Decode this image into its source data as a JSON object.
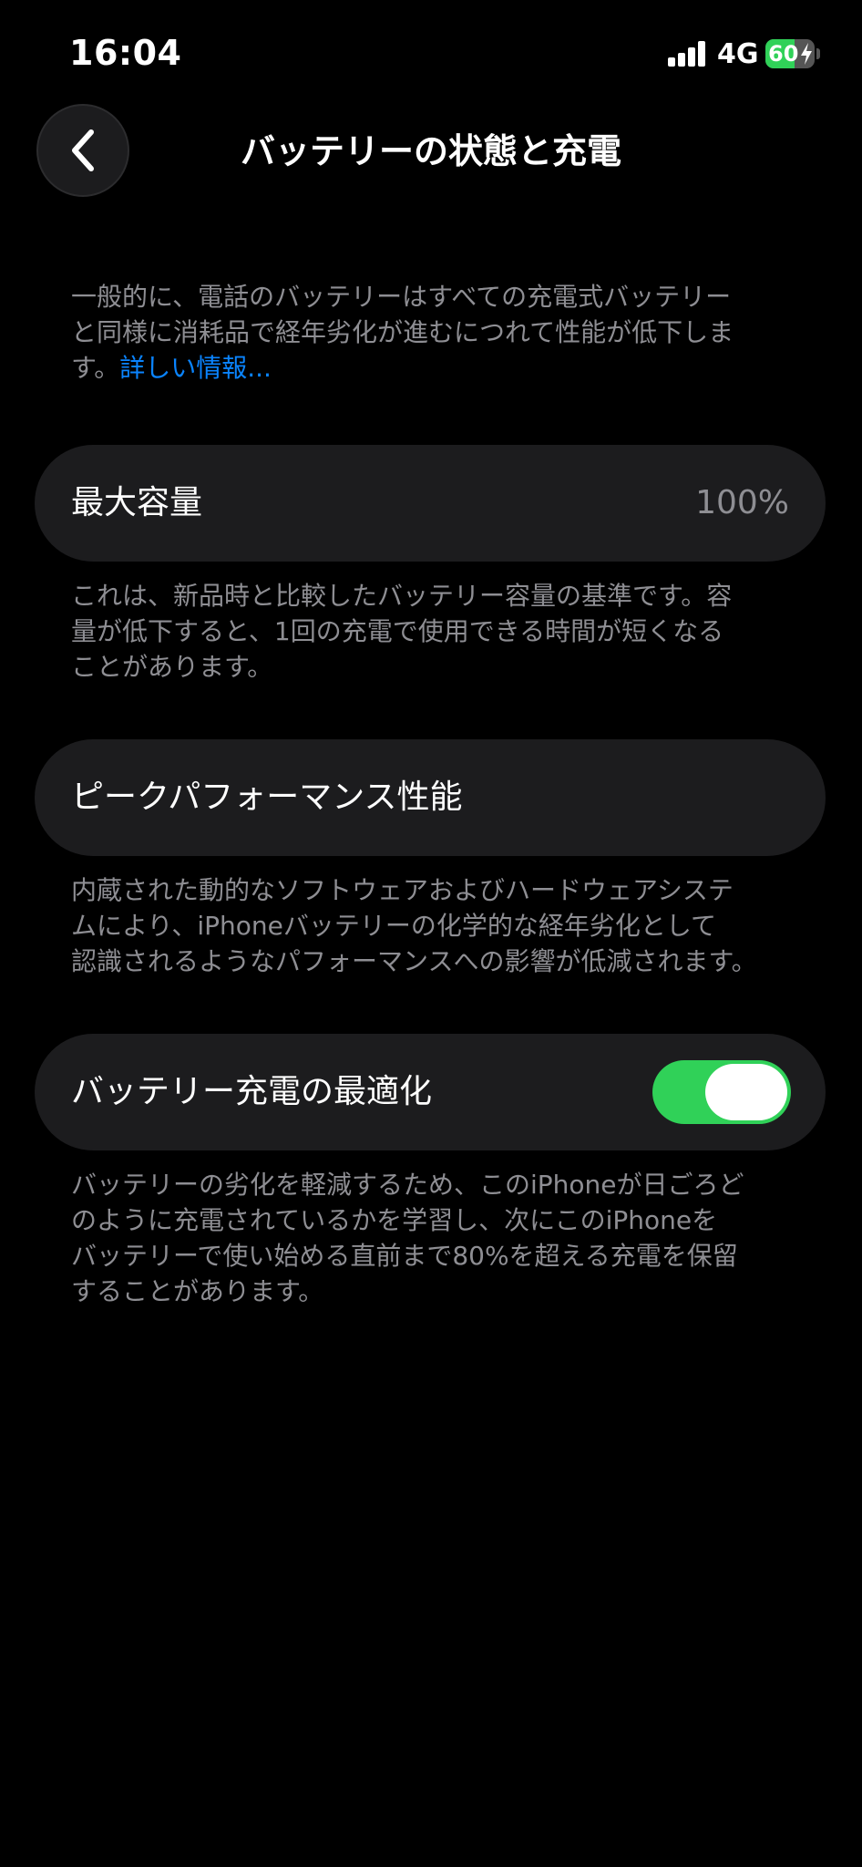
{
  "status_bar": {
    "time": "16:04",
    "network": "4G",
    "battery_percent": "60",
    "battery_level": 0.6,
    "charging": true
  },
  "nav": {
    "back_icon": "chevron-left-icon",
    "title": "バッテリーの状態と充電"
  },
  "intro": {
    "lines": [
      "一般的に、電話のバッテリーはすべての充電式バッテリー",
      "と同様に消耗品で経年劣化が進むにつれて性能が低下しま",
      "す。"
    ],
    "link": "詳しい情報..."
  },
  "max_capacity": {
    "label": "最大容量",
    "value": "100%",
    "footer_lines": [
      "これは、新品時と比較したバッテリー容量の基準です。容",
      "量が低下すると、1回の充電で使用できる時間が短くなる",
      "ことがあります。"
    ]
  },
  "peak_performance": {
    "label": "ピークパフォーマンス性能",
    "footer_lines": [
      "内蔵された動的なソフトウェアおよびハードウェアシステ",
      "ムにより、iPhoneバッテリーの化学的な経年劣化として",
      "認識されるようなパフォーマンスへの影響が低減されます。"
    ]
  },
  "optimized_charging": {
    "label": "バッテリー充電の最適化",
    "enabled": true,
    "footer_lines": [
      "バッテリーの劣化を軽減するため、このiPhoneが日ごろど",
      "のように充電されているかを学習し、次にこのiPhoneを",
      "バッテリーで使い始める直前まで80%を超える充電を保留",
      "することがあります。"
    ]
  },
  "colors": {
    "background": "#000000",
    "card": "#1c1c1e",
    "secondary_text": "#8e8e93",
    "link": "#0a84ff",
    "toggle_on": "#30d158"
  }
}
